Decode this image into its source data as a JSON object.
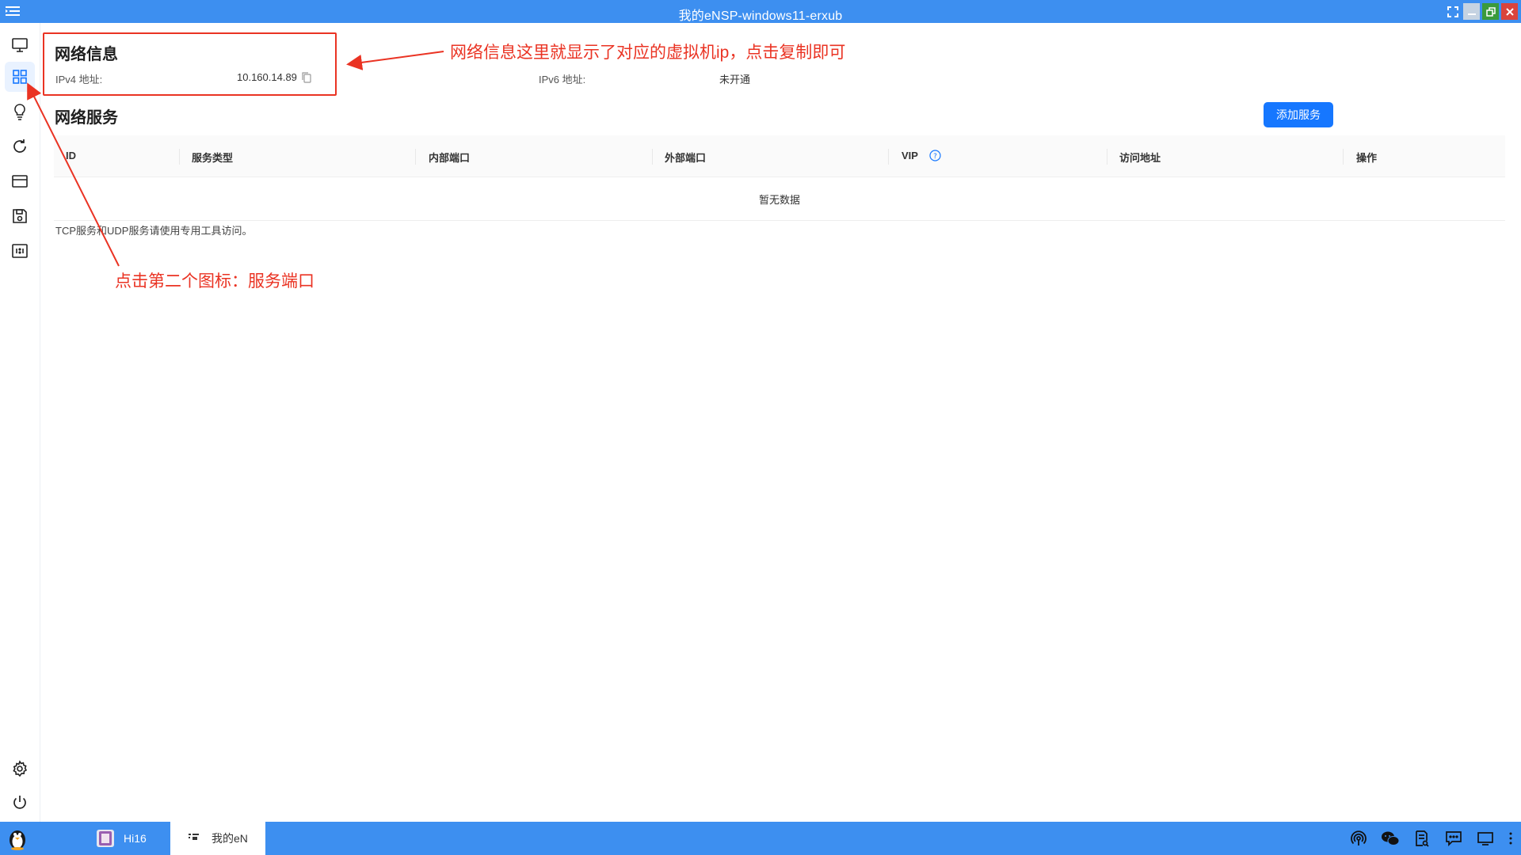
{
  "window": {
    "title": "我的eNSP-windows11-erxub"
  },
  "network_info": {
    "title": "网络信息",
    "ipv4_label": "IPv4 地址:",
    "ipv4_value": "10.160.14.89",
    "ipv6_label": "IPv6 地址:",
    "ipv6_value": "未开通"
  },
  "network_services": {
    "title": "网络服务",
    "add_button": "添加服务",
    "columns": [
      "ID",
      "服务类型",
      "内部端口",
      "外部端口",
      "VIP",
      "访问地址",
      "操作"
    ],
    "empty_text": "暂无数据",
    "note": "TCP服务和UDP服务请使用专用工具访问。"
  },
  "annotations": {
    "top": "网络信息这里就显示了对应的虚拟机ip，点击复制即可",
    "left": "点击第二个图标：服务端口",
    "color": "#ea3323"
  },
  "sidebar": {
    "items": [
      "monitor-icon",
      "grid-icon",
      "lightbulb-icon",
      "refresh-icon",
      "card-icon",
      "save-icon",
      "ratio-icon"
    ],
    "bottom": [
      "gear-icon",
      "power-icon"
    ]
  },
  "taskbar": {
    "tasks": [
      {
        "label": "Hi16"
      },
      {
        "label": "我的eN"
      }
    ]
  },
  "colors": {
    "accent": "#1677ff",
    "titlebar": "#3d8ff0"
  }
}
